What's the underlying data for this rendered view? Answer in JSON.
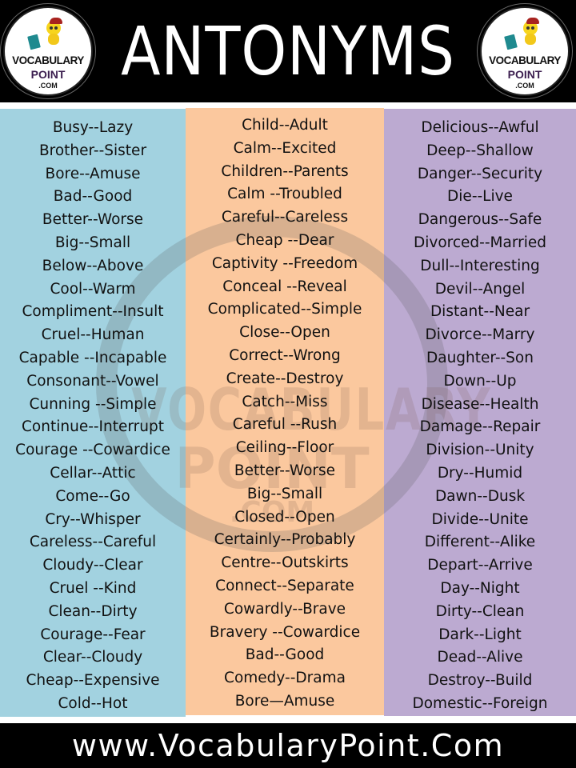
{
  "header": {
    "title": "ANTONYMS",
    "logo": {
      "line1": "VOCABULARY",
      "line2": "POINT",
      "line3": ".COM",
      "icon": "mascot-with-book-icon"
    }
  },
  "watermark": {
    "line1": "VOCABULARY",
    "line2": "POINT",
    "line3": ".COM"
  },
  "columns": [
    {
      "color": "#a2d2e0",
      "items": [
        "Busy--Lazy",
        "Brother--Sister",
        "Bore--Amuse",
        "Bad--Good",
        "Better--Worse",
        "Big--Small",
        "Below--Above",
        "Cool--Warm",
        "Compliment--Insult",
        "Cruel--Human",
        "Capable --Incapable",
        "Consonant--Vowel",
        "Cunning --Simple",
        "Continue--Interrupt",
        "Courage --Cowardice",
        "Cellar--Attic",
        "Come--Go",
        "Cry--Whisper",
        "Careless--Careful",
        "Cloudy--Clear",
        "Cruel --Kind",
        "Clean--Dirty",
        "Courage--Fear",
        "Clear--Cloudy",
        "Cheap--Expensive",
        "Cold--Hot"
      ]
    },
    {
      "color": "#fbc89e",
      "items": [
        "Child--Adult",
        "Calm--Excited",
        "Children--Parents",
        "Calm --Troubled",
        "Careful--Careless",
        "Cheap --Dear",
        "Captivity --Freedom",
        "Conceal --Reveal",
        "Complicated--Simple",
        "Close--Open",
        "Correct--Wrong",
        "Create--Destroy",
        "Catch--Miss",
        "Careful --Rush",
        "Ceiling--Floor",
        "Better--Worse",
        "Big--Small",
        "Closed--Open",
        "Certainly--Probably",
        "Centre--Outskirts",
        "Connect--Separate",
        "Cowardly--Brave",
        "Bravery --Cowardice",
        "Bad--Good",
        "Comedy--Drama",
        "Bore—Amuse"
      ]
    },
    {
      "color": "#bcaad1",
      "items": [
        "Delicious--Awful",
        "Deep--Shallow",
        "Danger--Security",
        "Die--Live",
        "Dangerous--Safe",
        "Divorced--Married",
        "Dull--Interesting",
        "Devil--Angel",
        "Distant--Near",
        "Divorce--Marry",
        "Daughter--Son",
        "Down--Up",
        "Disease--Health",
        "Damage--Repair",
        "Division--Unity",
        "Dry--Humid",
        "Dawn--Dusk",
        "Divide--Unite",
        "Different--Alike",
        "Depart--Arrive",
        "Day--Night",
        "Dirty--Clean",
        "Dark--Light",
        "Dead--Alive",
        "Destroy--Build",
        "Domestic--Foreign"
      ]
    }
  ],
  "footer": {
    "url": "www.VocabularyPoint.Com"
  }
}
